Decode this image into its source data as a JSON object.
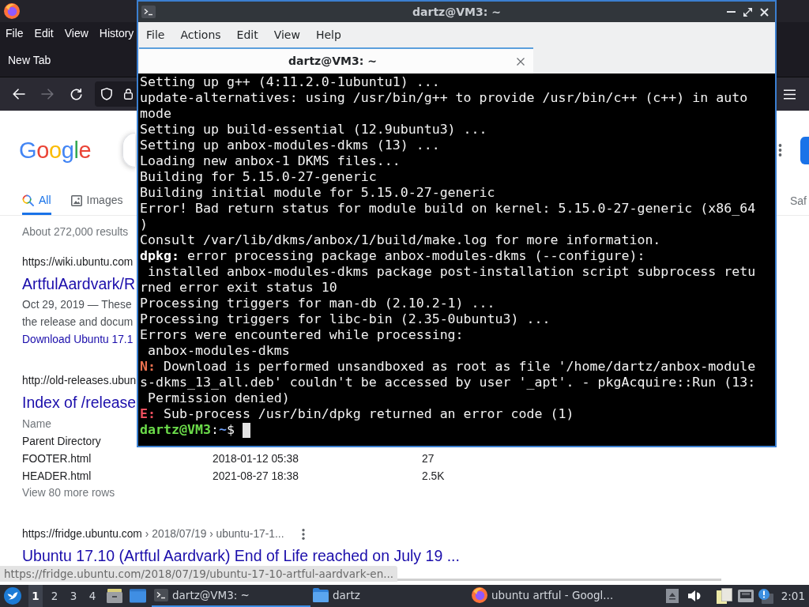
{
  "browser": {
    "menu": [
      "File",
      "Edit",
      "View",
      "History"
    ],
    "tabs": [
      {
        "label": "New Tab",
        "selected": false
      }
    ],
    "nav_buttons": [
      {
        "kind": "back",
        "disabled": false
      },
      {
        "kind": "forward",
        "disabled": true
      },
      {
        "kind": "reload",
        "disabled": false
      }
    ],
    "page": {
      "logo": "Google",
      "search_tabs": [
        {
          "kind": "all",
          "label": "All",
          "selected": true
        },
        {
          "kind": "images",
          "label": "Images",
          "selected": false
        }
      ],
      "side_text": "Saf",
      "result_count": "About 272,000 results",
      "results": [
        {
          "url": "https://wiki.ubuntu.com",
          "title": "ArtfulAardvark/R",
          "snippet": [
            "Oct 29, 2019 — These",
            "the release and docum"
          ],
          "link": "Download Ubuntu 17.1"
        },
        {
          "url": "http://old-releases.ubun",
          "title": "Index of /release",
          "table": {
            "columns": [
              "Name"
            ],
            "rows": [
              [
                "Parent Directory"
              ],
              [
                "FOOTER.html",
                "2018-01-12 05:38",
                "27"
              ],
              [
                "HEADER.html",
                "2021-08-27 18:38",
                "2.5K"
              ]
            ]
          },
          "more_rows": "View 80 more rows"
        },
        {
          "url": "https://fridge.ubuntu.com",
          "breadcrumb": "› 2018/07/19 › ubuntu-17-1...",
          "title": "Ubuntu 17.10 (Artful Aardvark) End of Life reached on July 19 ..."
        }
      ]
    },
    "status_link": "https://fridge.ubuntu.com/2018/07/19/ubuntu-17-10-artful-aardvark-en..."
  },
  "terminal": {
    "title": "dartz@VM3: ~",
    "menu": [
      "File",
      "Actions",
      "Edit",
      "View",
      "Help"
    ],
    "tabs": [
      {
        "label": "dartz@VM3: ~",
        "selected": true
      }
    ],
    "lines": [
      [
        {
          "kind": "plain",
          "text": "Setting up g++ (4:11.2.0-1ubuntu1) ..."
        }
      ],
      [
        {
          "kind": "plain",
          "text": "update-alternatives: using /usr/bin/g++ to provide /usr/bin/c++ (c++) in auto"
        }
      ],
      [
        {
          "kind": "plain",
          "text": "mode"
        }
      ],
      [
        {
          "kind": "plain",
          "text": "Setting up build-essential (12.9ubuntu3) ..."
        }
      ],
      [
        {
          "kind": "plain",
          "text": "Setting up anbox-modules-dkms (13) ..."
        }
      ],
      [
        {
          "kind": "plain",
          "text": "Loading new anbox-1 DKMS files..."
        }
      ],
      [
        {
          "kind": "plain",
          "text": "Building for 5.15.0-27-generic"
        }
      ],
      [
        {
          "kind": "plain",
          "text": "Building initial module for 5.15.0-27-generic"
        }
      ],
      [
        {
          "kind": "plain",
          "text": "Error! Bad return status for module build on kernel: 5.15.0-27-generic (x86_64"
        }
      ],
      [
        {
          "kind": "plain",
          "text": ")"
        }
      ],
      [
        {
          "kind": "plain",
          "text": "Consult /var/lib/dkms/anbox/1/build/make.log for more information."
        }
      ],
      [
        {
          "kind": "bold",
          "text": "dpkg:"
        },
        {
          "kind": "plain",
          "text": " error processing package anbox-modules-dkms (--configure):"
        }
      ],
      [
        {
          "kind": "plain",
          "text": " installed anbox-modules-dkms package post-installation script subprocess retu"
        }
      ],
      [
        {
          "kind": "plain",
          "text": "rned error exit status 10"
        }
      ],
      [
        {
          "kind": "plain",
          "text": "Processing triggers for man-db (2.10.2-1) ..."
        }
      ],
      [
        {
          "kind": "plain",
          "text": "Processing triggers for libc-bin (2.35-0ubuntu3) ..."
        }
      ],
      [
        {
          "kind": "plain",
          "text": "Errors were encountered while processing:"
        }
      ],
      [
        {
          "kind": "plain",
          "text": " anbox-modules-dkms"
        }
      ],
      [
        {
          "kind": "notice",
          "text": "N:"
        },
        {
          "kind": "plain",
          "text": " Download is performed unsandboxed as root as file '/home/dartz/anbox-module"
        }
      ],
      [
        {
          "kind": "plain",
          "text": "s-dkms_13_all.deb' couldn't be accessed by user '_apt'. - pkgAcquire::Run (13:"
        }
      ],
      [
        {
          "kind": "plain",
          "text": " Permission denied)"
        }
      ],
      [
        {
          "kind": "error",
          "text": "E:"
        },
        {
          "kind": "plain",
          "text": " Sub-process /usr/bin/dpkg returned an error code (1)"
        }
      ],
      [
        {
          "kind": "user",
          "text": "dartz@VM3"
        },
        {
          "kind": "plain",
          "text": ":"
        },
        {
          "kind": "path",
          "text": "~"
        },
        {
          "kind": "plain",
          "text": "$"
        }
      ]
    ]
  },
  "taskbar": {
    "workspaces": [
      {
        "label": "1",
        "selected": true
      },
      {
        "label": "2",
        "selected": false
      },
      {
        "label": "3",
        "selected": false
      },
      {
        "label": "4",
        "selected": false
      }
    ],
    "tasks": [
      {
        "kind": "terminal",
        "label": "dartz@VM3: ~",
        "selected": true
      },
      {
        "kind": "folder",
        "label": "dartz",
        "selected": false
      },
      {
        "kind": "browser",
        "label": "ubuntu artful - Googl...",
        "selected": false
      }
    ],
    "clock": "2:01"
  }
}
